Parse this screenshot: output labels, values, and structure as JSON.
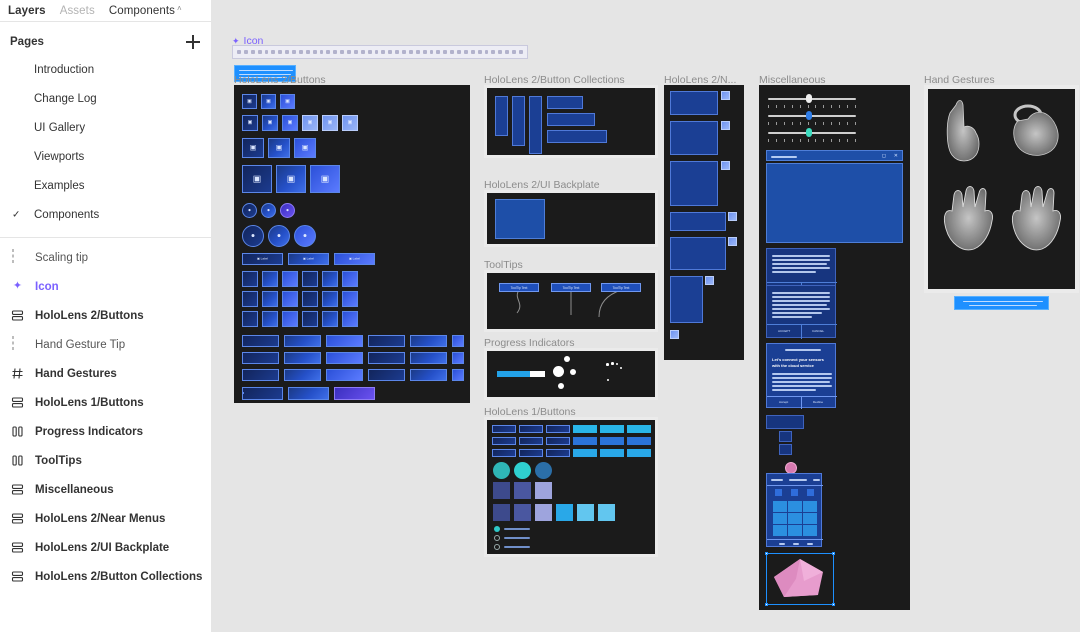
{
  "panel": {
    "tabs": [
      {
        "label": "Layers",
        "state": "active"
      },
      {
        "label": "Assets",
        "state": "disabled"
      },
      {
        "label": "Components",
        "state": "normal",
        "chevron": "˄"
      }
    ],
    "pages_header": {
      "title": "Pages",
      "add_label": "+"
    },
    "pages": [
      {
        "label": "Introduction",
        "selected": false
      },
      {
        "label": "Change Log",
        "selected": false
      },
      {
        "label": "UI Gallery",
        "selected": false
      },
      {
        "label": "Viewports",
        "selected": false
      },
      {
        "label": "Examples",
        "selected": false
      },
      {
        "label": "Components",
        "selected": true,
        "check": "✓"
      }
    ],
    "layers": [
      {
        "label": "Scaling tip",
        "icon": "frame-icon",
        "selected": false,
        "dim": true
      },
      {
        "label": "Icon",
        "icon": "component-icon",
        "selected": true,
        "dim": false
      },
      {
        "label": "HoloLens 2/Buttons",
        "icon": "component-set-icon",
        "selected": false,
        "dim": false
      },
      {
        "label": "Hand Gesture Tip",
        "icon": "frame-icon",
        "selected": false,
        "dim": true
      },
      {
        "label": "Hand Gestures",
        "icon": "grid-icon",
        "selected": false,
        "dim": false
      },
      {
        "label": "HoloLens 1/Buttons",
        "icon": "component-set-icon",
        "selected": false,
        "dim": false
      },
      {
        "label": "Progress Indicators",
        "icon": "bars-icon",
        "selected": false,
        "dim": false
      },
      {
        "label": "ToolTips",
        "icon": "bars-icon",
        "selected": false,
        "dim": false
      },
      {
        "label": "Miscellaneous",
        "icon": "component-set-icon",
        "selected": false,
        "dim": false
      },
      {
        "label": "HoloLens 2/Near Menus",
        "icon": "component-set-icon",
        "selected": false,
        "dim": false
      },
      {
        "label": "HoloLens 2/UI Backplate",
        "icon": "component-set-icon",
        "selected": false,
        "dim": false
      },
      {
        "label": "HoloLens 2/Button Collections",
        "icon": "component-set-icon",
        "selected": false,
        "dim": false
      }
    ]
  },
  "canvas": {
    "selected_frame_label": "Icon",
    "frames": [
      {
        "label": "HoloLens 2/Buttons"
      },
      {
        "label": "HoloLens 2/Button Collections"
      },
      {
        "label": "HoloLens 2/UI Backplate"
      },
      {
        "label": "ToolTips"
      },
      {
        "label": "Progress Indicators"
      },
      {
        "label": "HoloLens 1/Buttons"
      },
      {
        "label": "HoloLens 2/N..."
      },
      {
        "label": "Miscellaneous"
      },
      {
        "label": "Hand Gestures"
      }
    ],
    "tooltips_labels": [
      "ToolTip Text",
      "ToolTip Text",
      "ToolTip Text"
    ]
  },
  "colors": {
    "accent_purple": "#7b61ff",
    "canvas_bg": "#e5e5e5",
    "frame_bg": "#1b1b1b",
    "button_blue": "#2550c8",
    "tooltip_blue": "#1e90ff",
    "progress_blue": "#23a2e8",
    "cyan": "#2bc4c4",
    "pink": "#e79ccd"
  }
}
